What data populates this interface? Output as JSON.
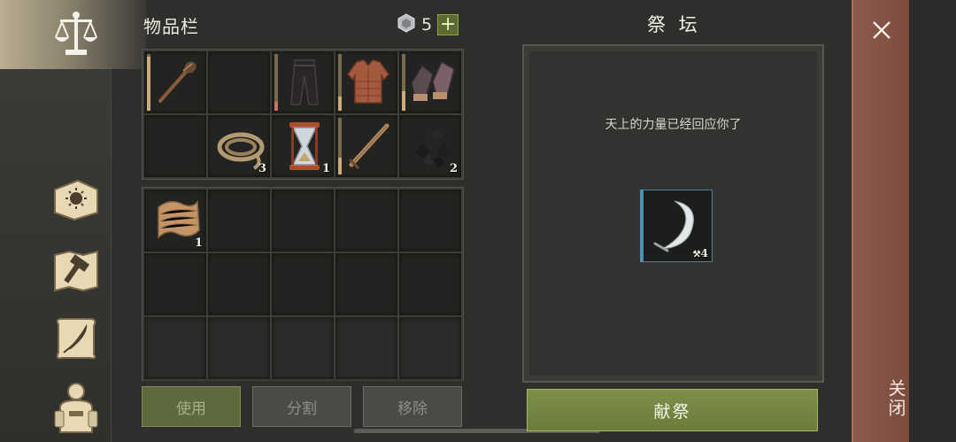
{
  "sidebar": {
    "active_tab_icon": "balance-scale-icon",
    "items": [
      {
        "icon": "sun-book-icon"
      },
      {
        "icon": "map-hammer-icon"
      },
      {
        "icon": "quill-scroll-icon"
      },
      {
        "icon": "character-backpack-icon"
      }
    ]
  },
  "inventory": {
    "title": "物品栏",
    "gem_count": "5",
    "plus_label": "+",
    "top_grid": [
      {
        "icon": "torch-club-icon",
        "durability": 0.95,
        "count": ""
      },
      {
        "icon": "",
        "count": ""
      },
      {
        "icon": "pants-icon",
        "durability": 0.15,
        "count": ""
      },
      {
        "icon": "padded-armor-icon",
        "durability": 0.25,
        "count": ""
      },
      {
        "icon": "gloves-icon",
        "durability": 0.35,
        "count": ""
      },
      {
        "icon": "",
        "count": ""
      },
      {
        "icon": "rope-coil-icon",
        "count": "3"
      },
      {
        "icon": "hourglass-icon",
        "count": "1"
      },
      {
        "icon": "wooden-sword-icon",
        "durability": 0.3,
        "count": ""
      },
      {
        "icon": "coal-pile-icon",
        "count": "2"
      }
    ],
    "mid_grid": [
      {
        "icon": "cloth-scroll-icon",
        "count": "1"
      }
    ],
    "buttons": {
      "use": "使用",
      "split": "分割",
      "remove": "移除"
    }
  },
  "altar": {
    "title": "祭 坛",
    "message": "天上的力量已经回应你了",
    "slot_icon": "sickle-icon",
    "slot_count": "4",
    "offer_label": "献祭"
  },
  "close": {
    "label": "关闭",
    "icon": "close-icon"
  },
  "colors": {
    "accent_green": "#7e8f4b",
    "close_bar": "#8a5b4b"
  }
}
